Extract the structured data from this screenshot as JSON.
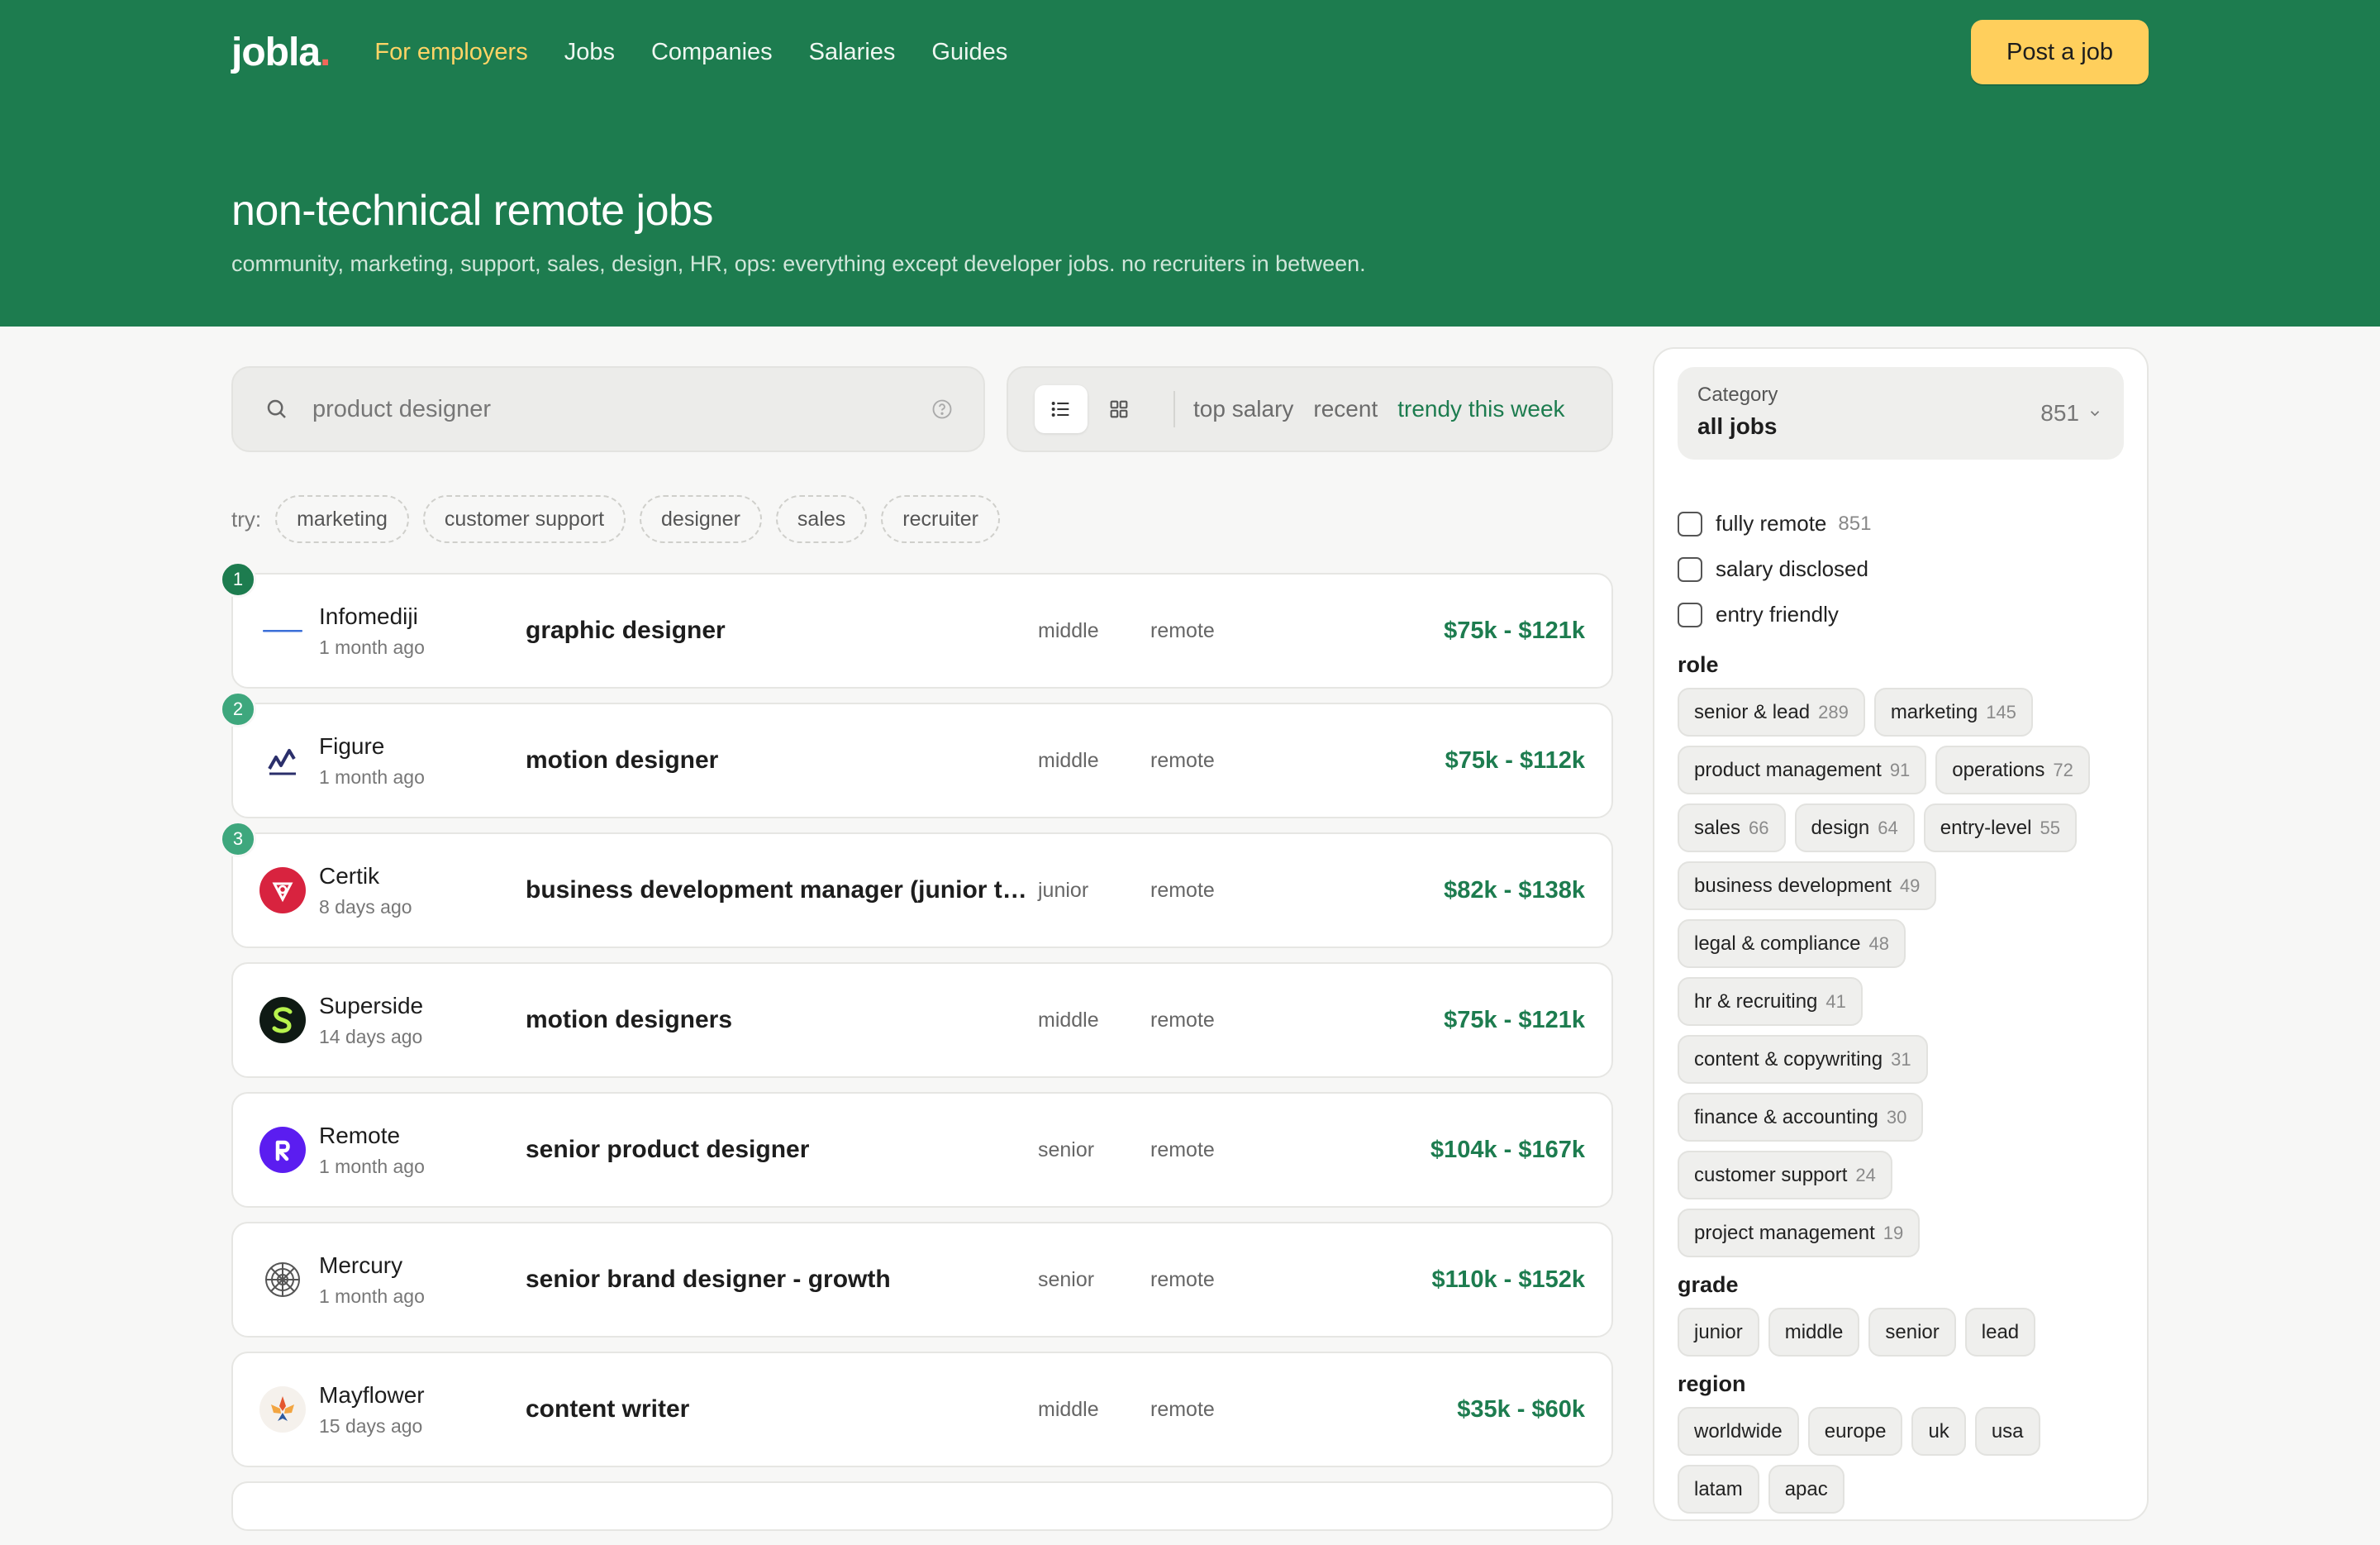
{
  "nav": {
    "logo": "jobla",
    "logo_dot": ".",
    "links": [
      "For employers",
      "Jobs",
      "Companies",
      "Salaries",
      "Guides"
    ],
    "post_button": "Post a job"
  },
  "hero": {
    "title": "non-technical remote jobs",
    "subtitle": "community, marketing, support, sales, design, HR, ops: everything except developer jobs. no recruiters in between."
  },
  "search": {
    "value": "product designer"
  },
  "sort": {
    "options": [
      "top salary",
      "recent",
      "trendy this week"
    ],
    "active": "trendy this week"
  },
  "try": {
    "label": "try:",
    "suggestions": [
      "marketing",
      "customer support",
      "designer",
      "sales",
      "recruiter"
    ]
  },
  "jobs": [
    {
      "rank": "1",
      "company": "Infomediji",
      "posted": "1 month ago",
      "title": "graphic designer",
      "grade": "middle",
      "location": "remote",
      "salary": "$75k - $121k",
      "logo": "infomediji-logo"
    },
    {
      "rank": "2",
      "company": "Figure",
      "posted": "1 month ago",
      "title": "motion designer",
      "grade": "middle",
      "location": "remote",
      "salary": "$75k - $112k",
      "logo": "figure-logo"
    },
    {
      "rank": "3",
      "company": "Certik",
      "posted": "8 days ago",
      "title": "business development manager (junior to mid-level)",
      "grade": "junior",
      "location": "remote",
      "salary": "$82k - $138k",
      "logo": "certik-logo"
    },
    {
      "company": "Superside",
      "posted": "14 days ago",
      "title": "motion designers",
      "grade": "middle",
      "location": "remote",
      "salary": "$75k - $121k",
      "logo": "superside-logo"
    },
    {
      "company": "Remote",
      "posted": "1 month ago",
      "title": "senior product designer",
      "grade": "senior",
      "location": "remote",
      "salary": "$104k - $167k",
      "logo": "remote-logo"
    },
    {
      "company": "Mercury",
      "posted": "1 month ago",
      "title": "senior brand designer - growth",
      "grade": "senior",
      "location": "remote",
      "salary": "$110k - $152k",
      "logo": "mercury-logo"
    },
    {
      "company": "Mayflower",
      "posted": "15 days ago",
      "title": "content writer",
      "grade": "middle",
      "location": "remote",
      "salary": "$35k - $60k",
      "logo": "mayflower-logo"
    }
  ],
  "sidebar": {
    "category": {
      "label": "Category",
      "value": "all jobs",
      "count": "851"
    },
    "checks": [
      {
        "label": "fully remote",
        "count": "851"
      },
      {
        "label": "salary disclosed",
        "count": ""
      },
      {
        "label": "entry friendly",
        "count": ""
      }
    ],
    "role_title": "role",
    "roles": [
      {
        "label": "senior & lead",
        "count": "289"
      },
      {
        "label": "marketing",
        "count": "145"
      },
      {
        "label": "product management",
        "count": "91"
      },
      {
        "label": "operations",
        "count": "72"
      },
      {
        "label": "sales",
        "count": "66"
      },
      {
        "label": "design",
        "count": "64"
      },
      {
        "label": "entry-level",
        "count": "55"
      },
      {
        "label": "business development",
        "count": "49"
      },
      {
        "label": "legal & compliance",
        "count": "48"
      },
      {
        "label": "hr & recruiting",
        "count": "41"
      },
      {
        "label": "content & copywriting",
        "count": "31"
      },
      {
        "label": "finance & accounting",
        "count": "30"
      },
      {
        "label": "customer support",
        "count": "24"
      },
      {
        "label": "project management",
        "count": "19"
      }
    ],
    "grade_title": "grade",
    "grades": [
      "junior",
      "middle",
      "senior",
      "lead"
    ],
    "region_title": "region",
    "regions": [
      "worldwide",
      "europe",
      "uk",
      "usa",
      "latam",
      "apac"
    ]
  },
  "colors": {
    "brand_green": "#1d7c4f",
    "accent_yellow": "#ffcf5c",
    "logo_dot": "#f0685a"
  }
}
